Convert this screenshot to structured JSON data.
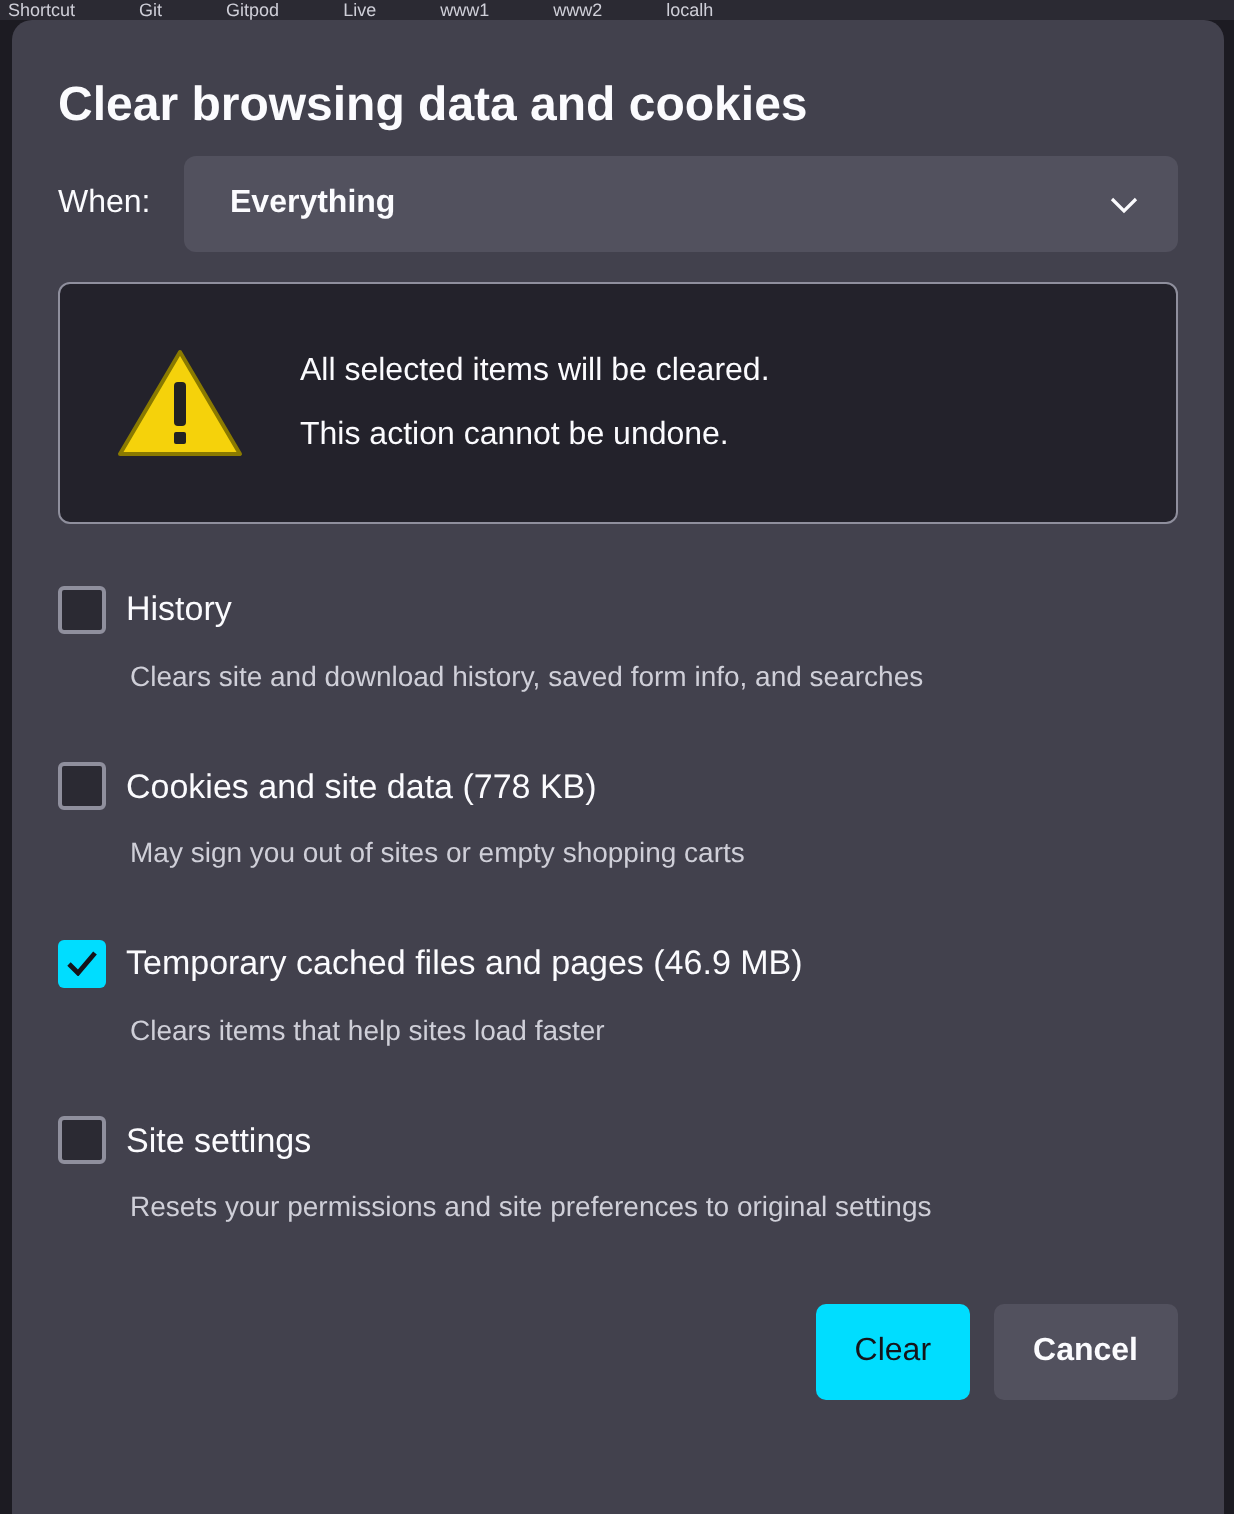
{
  "bookmarks": [
    {
      "label": "Shortcut"
    },
    {
      "label": "Git"
    },
    {
      "label": "Gitpod"
    },
    {
      "label": "Live"
    },
    {
      "label": "www1"
    },
    {
      "label": "www2"
    },
    {
      "label": "localh"
    }
  ],
  "dialog": {
    "title": "Clear browsing data and cookies",
    "when": {
      "label": "When:",
      "value": "Everything"
    },
    "warning": [
      "All selected items will be cleared.",
      "This action cannot be undone."
    ],
    "options": [
      {
        "label": "History",
        "description": "Clears site and download history, saved form info, and searches",
        "checked": false
      },
      {
        "label": "Cookies and site data (778 KB)",
        "description": "May sign you out of sites or empty shopping carts",
        "checked": false
      },
      {
        "label": "Temporary cached files and pages (46.9 MB)",
        "description": "Clears items that help sites load faster",
        "checked": true
      },
      {
        "label": "Site settings",
        "description": "Resets your permissions and site preferences to original settings",
        "checked": false
      }
    ],
    "buttons": [
      {
        "label": "Clear",
        "kind": "primary"
      },
      {
        "label": "Cancel",
        "kind": "secondary"
      }
    ]
  }
}
